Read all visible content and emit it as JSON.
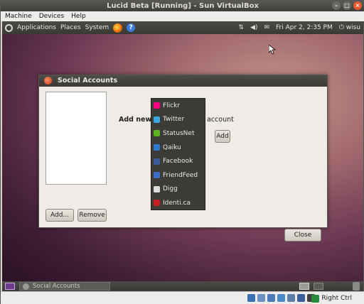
{
  "window": {
    "title": "Lucid Beta [Running] - Sun VirtualBox"
  },
  "menubar": {
    "items": [
      "Machine",
      "Devices",
      "Help"
    ]
  },
  "panel": {
    "menus": [
      "Applications",
      "Places",
      "System"
    ],
    "datetime": "Fri Apr  2,  2:35 PM",
    "user": "wisu"
  },
  "dialog": {
    "title": "Social Accounts",
    "add_new": "Add new",
    "account": "account",
    "add_button": "Add...",
    "remove_button": "Remove",
    "add_account_button": "Add",
    "close_button": "Close"
  },
  "dropdown": {
    "items": [
      {
        "label": "Flickr",
        "icon": "flickr-icon",
        "color": "#ff0084"
      },
      {
        "label": "Twitter",
        "icon": "twitter-icon",
        "color": "#3aa7e0"
      },
      {
        "label": "StatusNet",
        "icon": "statusnet-icon",
        "color": "#5bb51d"
      },
      {
        "label": "Qaiku",
        "icon": "qaiku-icon",
        "color": "#2f7bd1"
      },
      {
        "label": "Facebook",
        "icon": "facebook-icon",
        "color": "#3b5998"
      },
      {
        "label": "FriendFeed",
        "icon": "friendfeed-icon",
        "color": "#3b6fc7"
      },
      {
        "label": "Digg",
        "icon": "digg-icon",
        "color": "#dddddd"
      },
      {
        "label": "Identi.ca",
        "icon": "identica-icon",
        "color": "#c71c22"
      }
    ]
  },
  "taskbar": {
    "item": "Social Accounts"
  },
  "statusbar": {
    "host_key": "Right Ctrl"
  }
}
